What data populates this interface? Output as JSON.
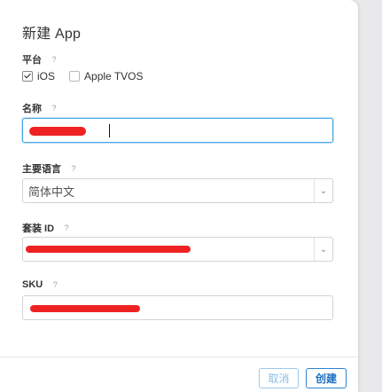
{
  "dialog": {
    "title": "新建 App",
    "help_glyph": "?",
    "platform": {
      "label": "平台",
      "options": [
        {
          "label": "iOS",
          "checked": true
        },
        {
          "label": "Apple TVOS",
          "checked": false
        }
      ]
    },
    "name": {
      "label": "名称",
      "value": ""
    },
    "primary_language": {
      "label": "主要语言",
      "value": "简体中文"
    },
    "bundle_id": {
      "label": "套装 ID",
      "value": ""
    },
    "sku": {
      "label": "SKU",
      "value": ""
    },
    "buttons": {
      "cancel": "取消",
      "create": "创建"
    }
  },
  "colors": {
    "focus_border": "#4aa8e8",
    "primary_button": "#2e84d2",
    "redaction": "#ee2222"
  },
  "icons": {
    "help": "question-icon",
    "select": "chevron-down-icon",
    "checkbox": "checkmark-icon"
  }
}
